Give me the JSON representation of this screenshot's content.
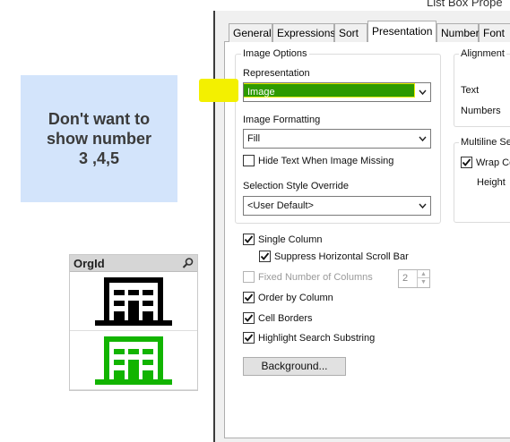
{
  "note": {
    "text": "Don't want to\nshow number\n3 ,4,5"
  },
  "listbox": {
    "caption": "OrgId",
    "search_icon": "magnifier-icon",
    "rows": [
      {
        "icon": "office-building-icon",
        "color": "#000000"
      },
      {
        "icon": "office-building-icon",
        "color": "#12b400"
      }
    ]
  },
  "dialog": {
    "title": "List Box Prope",
    "tabs": [
      "General",
      "Expressions",
      "Sort",
      "Presentation",
      "Number",
      "Font"
    ],
    "active_tab": "Presentation",
    "image_options": {
      "group_label": "Image Options",
      "representation_label": "Representation",
      "representation_value": "Image",
      "image_formatting_label": "Image Formatting",
      "image_formatting_value": "Fill",
      "hide_text_label": "Hide Text When Image Missing",
      "hide_text_checked": false,
      "selection_style_label": "Selection Style Override",
      "selection_style_value": "<User Default>"
    },
    "alignment": {
      "group_label": "Alignment",
      "text_label": "Text",
      "numbers_label": "Numbers"
    },
    "multiline": {
      "group_label": "Multiline Se",
      "wrap_label": "Wrap Ce",
      "wrap_checked": true,
      "height_label": "Height"
    },
    "options": {
      "single_column": {
        "label": "Single Column",
        "checked": true
      },
      "suppress_scroll": {
        "label": "Suppress Horizontal Scroll Bar",
        "checked": true
      },
      "fixed_columns": {
        "label": "Fixed Number of Columns",
        "checked": false,
        "value": "2"
      },
      "order_by_column": {
        "label": "Order by Column",
        "checked": true
      },
      "cell_borders": {
        "label": "Cell Borders",
        "checked": true
      },
      "highlight_search": {
        "label": "Highlight Search Substring",
        "checked": true
      }
    },
    "background_button": "Background...",
    "colors": {
      "marker_yellow": "#f3f000",
      "selection_green": "#2e9a00"
    }
  }
}
